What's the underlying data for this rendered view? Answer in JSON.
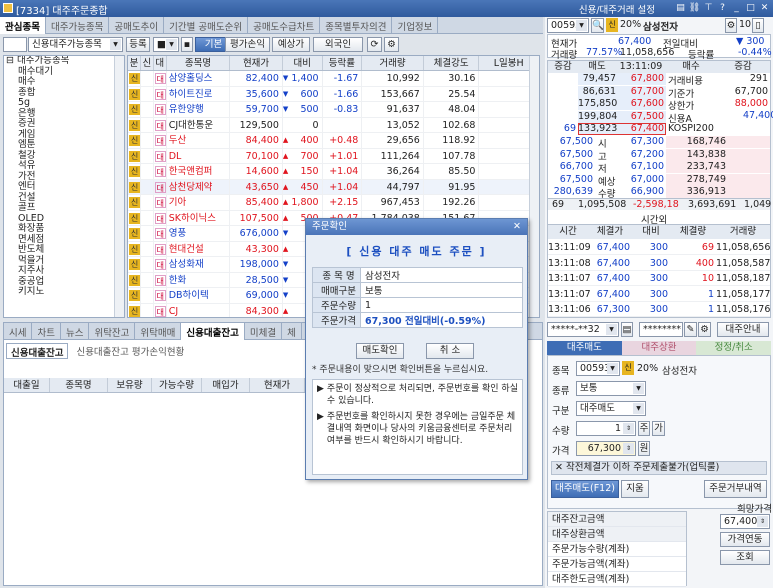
{
  "window": {
    "title": "[7334] 대주주문종합",
    "right_title": "신용/대주거래 설정"
  },
  "main_tabs": [
    "관심종목",
    "대주가능종목",
    "공매도추이",
    "기간별 공매도순위",
    "공매도수급차트",
    "종목별투자의견",
    "기업정보"
  ],
  "toolbar": {
    "group_select": "신용대주가능종목",
    "register_btn": "등록",
    "view_select": "■",
    "btn_basic": "기본",
    "btn_eval": "평가손익",
    "btn_expect": "예상가",
    "btn_foreign": "외국인"
  },
  "tree": {
    "root": "대주가능종목",
    "items": [
      "매수대기",
      "매수",
      "종합",
      "5g",
      "은행",
      "증권",
      "게임",
      "엠툰",
      "철강",
      "석유",
      "가전",
      "엔터",
      "건설",
      "골프",
      "OLED",
      "화장품",
      "면세점",
      "반도체",
      "먹을거",
      "지주사",
      "중공업",
      "키지노"
    ]
  },
  "grid": {
    "headers": [
      "분",
      "신",
      "대",
      "종목명",
      "현재가",
      "대비",
      "등락률",
      "거래량",
      "체결강도",
      "L일봉H"
    ],
    "rows": [
      {
        "name": "삼양홀딩스",
        "price": "82,400",
        "dir": "down",
        "change": "1,400",
        "rate": "-1.67",
        "volume": "10,992",
        "strength": "30.16",
        "tag": "신"
      },
      {
        "name": "하이트진로",
        "price": "35,600",
        "dir": "down",
        "change": "600",
        "rate": "-1.66",
        "volume": "153,667",
        "strength": "25.54",
        "tag": "신"
      },
      {
        "name": "유한양행",
        "price": "59,700",
        "dir": "down",
        "change": "500",
        "rate": "-0.83",
        "volume": "91,637",
        "strength": "48.04",
        "tag": "신"
      },
      {
        "name": "CJ대한통운",
        "price": "129,500",
        "dir": "none",
        "change": "0",
        "rate": "",
        "volume": "13,052",
        "strength": "102.68",
        "tag": "신"
      },
      {
        "name": "두산",
        "price": "84,400",
        "dir": "up",
        "change": "400",
        "rate": "+0.48",
        "volume": "29,656",
        "strength": "118.92",
        "tag": "신"
      },
      {
        "name": "DL",
        "price": "70,100",
        "dir": "up",
        "change": "700",
        "rate": "+1.01",
        "volume": "111,264",
        "strength": "107.78",
        "tag": "신"
      },
      {
        "name": "한국앤컴퍼",
        "price": "14,600",
        "dir": "up",
        "change": "150",
        "rate": "+1.04",
        "volume": "36,264",
        "strength": "85.50",
        "tag": "신"
      },
      {
        "name": "삼천당제약",
        "price": "43,650",
        "dir": "up",
        "change": "450",
        "rate": "+1.04",
        "volume": "44,797",
        "strength": "91.95",
        "tag": "신"
      },
      {
        "name": "기아",
        "price": "85,400",
        "dir": "up",
        "change": "1,800",
        "rate": "+2.15",
        "volume": "967,453",
        "strength": "192.26",
        "tag": "신"
      },
      {
        "name": "SK하이닉스",
        "price": "107,500",
        "dir": "up",
        "change": "500",
        "rate": "+0.47",
        "volume": "1,784,038",
        "strength": "151.67",
        "tag": "신"
      },
      {
        "name": "영풍",
        "price": "676,000",
        "dir": "down",
        "change": "",
        "rate": "",
        "volume": "",
        "strength": "",
        "tag": "신"
      },
      {
        "name": "현대건설",
        "price": "43,300",
        "dir": "up",
        "change": "",
        "rate": "",
        "volume": "",
        "strength": "",
        "tag": "신"
      },
      {
        "name": "삼성화재",
        "price": "198,000",
        "dir": "down",
        "change": "",
        "rate": "",
        "volume": "",
        "strength": "",
        "tag": "신"
      },
      {
        "name": "한화",
        "price": "28,500",
        "dir": "down",
        "change": "",
        "rate": "",
        "volume": "",
        "strength": "",
        "tag": "신"
      },
      {
        "name": "DB하이텍",
        "price": "69,000",
        "dir": "down",
        "change": "",
        "rate": "",
        "volume": "",
        "strength": "",
        "tag": "신"
      },
      {
        "name": "CJ",
        "price": "84,300",
        "dir": "up",
        "change": "",
        "rate": "",
        "volume": "",
        "strength": "",
        "tag": "신"
      }
    ]
  },
  "bottom": {
    "tabs": [
      "시세",
      "차트",
      "뉴스",
      "위탁잔고",
      "위탁매매",
      "신용대출잔고",
      "미체결",
      "체"
    ],
    "subtabs": [
      "신용대출잔고",
      "신용대출잔고 평가손익현황"
    ],
    "headers": [
      "대출일",
      "종목명",
      "보유량",
      "가능수량",
      "매입가",
      "현재가"
    ]
  },
  "dialog": {
    "title": "주문확인",
    "heading": "[ 신용 대주 매도 주문 ]",
    "rows": [
      {
        "k": "종 목 명",
        "v": "삼성전자"
      },
      {
        "k": "매매구분",
        "v": "보통"
      },
      {
        "k": "주문수량",
        "v": "1"
      },
      {
        "k": "주문가격",
        "v": "67,300   전일대비(-0.59%)"
      }
    ],
    "note": "* 주문내용이 맞으시면 확인버튼을 누르십시요.",
    "confirm": "매도확인",
    "cancel": "취 소",
    "info1": "주문이 정상적으로 처리되면, 주문번호를 확인 하실 수 있습니다.",
    "info2": "주문번호를 확인하시지 못한 경우에는 금일주문 체결내역 화면이나 당사의 키움금융센터로 주문처리 여부를 반드시 확인하시기 바랍니다."
  },
  "quote": {
    "code": "005930",
    "margin": "20%",
    "name": "삼성전자",
    "num_badge": "10",
    "price_label": "현재가",
    "price": "67,400",
    "prev_label": "전일대비",
    "prev": "300",
    "rate_label": "거래량",
    "rate": "77.57%",
    "volume": "11,058,656",
    "chg_label": "등락률",
    "chg": "-0.44%",
    "ob_head": [
      "증감",
      "매도",
      "13:11:09",
      "매수",
      "증감"
    ],
    "asks": [
      {
        "qty": "79,457",
        "price": "67,800",
        "label": "거래비용",
        "val": "291"
      },
      {
        "qty": "86,631",
        "price": "67,700",
        "label": "기준가",
        "val": "67,700"
      },
      {
        "qty": "175,850",
        "price": "67,600",
        "label": "상한가",
        "val": "88,000"
      },
      {
        "qty": "199,804",
        "price": "67,500",
        "label": "신용A",
        "val": ""
      },
      {
        "qty": "133,923",
        "price": "67,400",
        "label": "KOSPI200",
        "val": ""
      }
    ],
    "asks_left": [
      "",
      "",
      "",
      "",
      "69"
    ],
    "bids": [
      {
        "label": "시",
        "price": "67,300",
        "qty": "168,746",
        "left": "67,500"
      },
      {
        "label": "고",
        "price": "67,200",
        "qty": "143,838",
        "left": "67,500"
      },
      {
        "label": "저",
        "price": "67,100",
        "qty": "233,743",
        "left": "66,700"
      },
      {
        "label": "예상",
        "price": "67,000",
        "qty": "278,749",
        "left": "67,500"
      },
      {
        "label": "수량",
        "price": "66,900",
        "qty": "336,913",
        "left": "280,639"
      }
    ],
    "bid_right_val": "47,400",
    "totals": {
      "l": "69",
      "ask": "1,095,508",
      "diff": "-2,598,18",
      "bid": "3,693,691",
      "r": "1,049"
    },
    "totals_label": "시간외",
    "ticks_head": [
      "시간",
      "체결가",
      "대비",
      "체결량",
      "거래량"
    ],
    "ticks": [
      {
        "time": "13:11:09",
        "price": "67,400",
        "chg": "300",
        "qty": "69",
        "vol": "11,058,656"
      },
      {
        "time": "13:11:08",
        "price": "67,400",
        "chg": "300",
        "qty": "400",
        "vol": "11,058,587"
      },
      {
        "time": "13:11:07",
        "price": "67,400",
        "chg": "300",
        "qty": "10",
        "vol": "11,058,187"
      },
      {
        "time": "13:11:07",
        "price": "67,400",
        "chg": "300",
        "qty": "1",
        "vol": "11,058,177"
      },
      {
        "time": "13:11:06",
        "price": "67,300",
        "chg": "300",
        "qty": "1",
        "vol": "11,058,176"
      }
    ]
  },
  "order": {
    "account": "*****-**32",
    "password": "********",
    "guide_btn": "대주안내",
    "tabs": [
      "대주매도",
      "대주상환",
      "정정/취소"
    ],
    "code_label": "종목",
    "code": "005930",
    "margin": "20%",
    "name": "삼성전자",
    "type_label": "종류",
    "type": "보통",
    "kind_label": "구분",
    "kind": "대주매도",
    "qty_label": "수량",
    "qty": "1",
    "qty_unit": "주",
    "qty_btn": "가",
    "price_label": "가격",
    "price": "67,300",
    "price_unit": "원",
    "notice": "작전체결가 이하 주문제출불가(업틱룰)",
    "sell_btn": "대주매도(F12)",
    "reset_btn": "지움",
    "history_btn": "주문거부내역",
    "summary_labels": [
      "대주잔고금액",
      "대주상환금액",
      "주문가능수량(계좌)",
      "주문가능금액(계좌)",
      "대주한도금액(계좌)"
    ],
    "hope_label": "희망가격",
    "hope_price": "67,400",
    "price_link_btn": "가격연동",
    "query_btn": "조회"
  },
  "colors": {
    "accent": "#3e6db5",
    "up": "#e0141e",
    "down": "#1440c8"
  }
}
